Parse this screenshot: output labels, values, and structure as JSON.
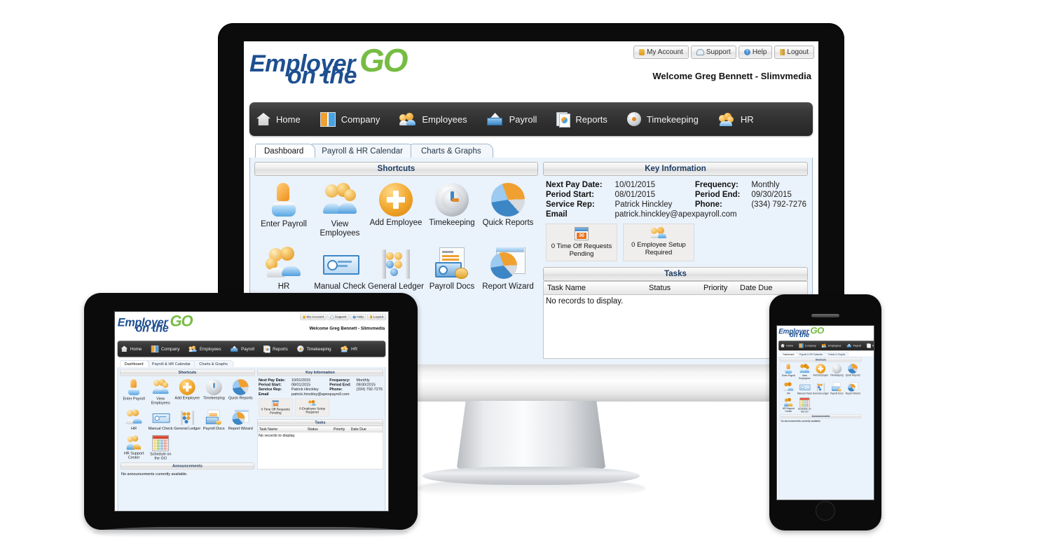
{
  "brand": {
    "line1": "Employer",
    "line2": "on the",
    "go": "GO",
    "blue": "#1d4f91",
    "green": "#76bc43"
  },
  "header": {
    "welcome": "Welcome Greg Bennett - Slimvmedia",
    "buttons": [
      {
        "label": "My Account",
        "icon": "user-account-icon"
      },
      {
        "label": "Support",
        "icon": "lifebuoy-support-icon"
      },
      {
        "label": "Help",
        "icon": "question-help-icon"
      },
      {
        "label": "Logout",
        "icon": "door-logout-icon"
      }
    ]
  },
  "nav": [
    {
      "label": "Home",
      "icon": "house-icon"
    },
    {
      "label": "Company",
      "icon": "building-icon"
    },
    {
      "label": "Employees",
      "icon": "people-icon"
    },
    {
      "label": "Payroll",
      "icon": "envelope-check-icon"
    },
    {
      "label": "Reports",
      "icon": "documents-icon"
    },
    {
      "label": "Timekeeping",
      "icon": "clock-icon"
    },
    {
      "label": "HR",
      "icon": "group-icon"
    }
  ],
  "tabs": [
    {
      "label": "Dashboard",
      "active": true
    },
    {
      "label": "Payroll & HR Calendar",
      "active": false
    },
    {
      "label": "Charts & Graphs",
      "active": false
    }
  ],
  "shortcuts_panel": {
    "title": "Shortcuts",
    "items": [
      {
        "label": "Enter Payroll",
        "icon": "hand-press-icon"
      },
      {
        "label": "View Employees",
        "icon": "people-group-icon"
      },
      {
        "label": "Add Employee",
        "icon": "plus-circle-icon"
      },
      {
        "label": "Timekeeping",
        "icon": "clock-dial-icon"
      },
      {
        "label": "Quick Reports",
        "icon": "pie-chart-icon"
      },
      {
        "label": "HR",
        "icon": "people-group-icon"
      },
      {
        "label": "Manual Check",
        "icon": "check-document-icon"
      },
      {
        "label": "General Ledger",
        "icon": "abacus-icon"
      },
      {
        "label": "Payroll Docs",
        "icon": "payroll-docs-icon"
      },
      {
        "label": "Report Wizard",
        "icon": "report-window-icon"
      },
      {
        "label": "HR Support Center",
        "icon": "two-people-icon"
      },
      {
        "label": "Schedule on the GO",
        "icon": "calendar-icon"
      }
    ]
  },
  "key_information": {
    "title": "Key Information",
    "rows": [
      {
        "label1": "Next Pay Date:",
        "value1": "10/01/2015",
        "label2": "Frequency:",
        "value2": "Monthly"
      },
      {
        "label1": "Period Start:",
        "value1": "08/01/2015",
        "label2": "Period End:",
        "value2": "09/30/2015"
      },
      {
        "label1": "Service Rep:",
        "value1": "Patrick Hinckley",
        "label2": "Phone:",
        "value2": "(334) 792-7276"
      }
    ],
    "email_label": "Email",
    "email_value": "patrick.hinckley@apexpayroll.com",
    "badges": [
      {
        "line1": "0 Time Off Requests",
        "line2": "Pending",
        "icon": "calendar-30-icon"
      },
      {
        "line1": "0 Employee Setup",
        "line2": "Required",
        "icon": "two-people-icon"
      }
    ]
  },
  "tasks": {
    "title": "Tasks",
    "columns": [
      "Task Name",
      "Status",
      "Priority",
      "Date Due"
    ],
    "empty_message": "No records to display."
  },
  "announcements": {
    "title": "Announcements",
    "empty_message": "No announcements currently available."
  }
}
